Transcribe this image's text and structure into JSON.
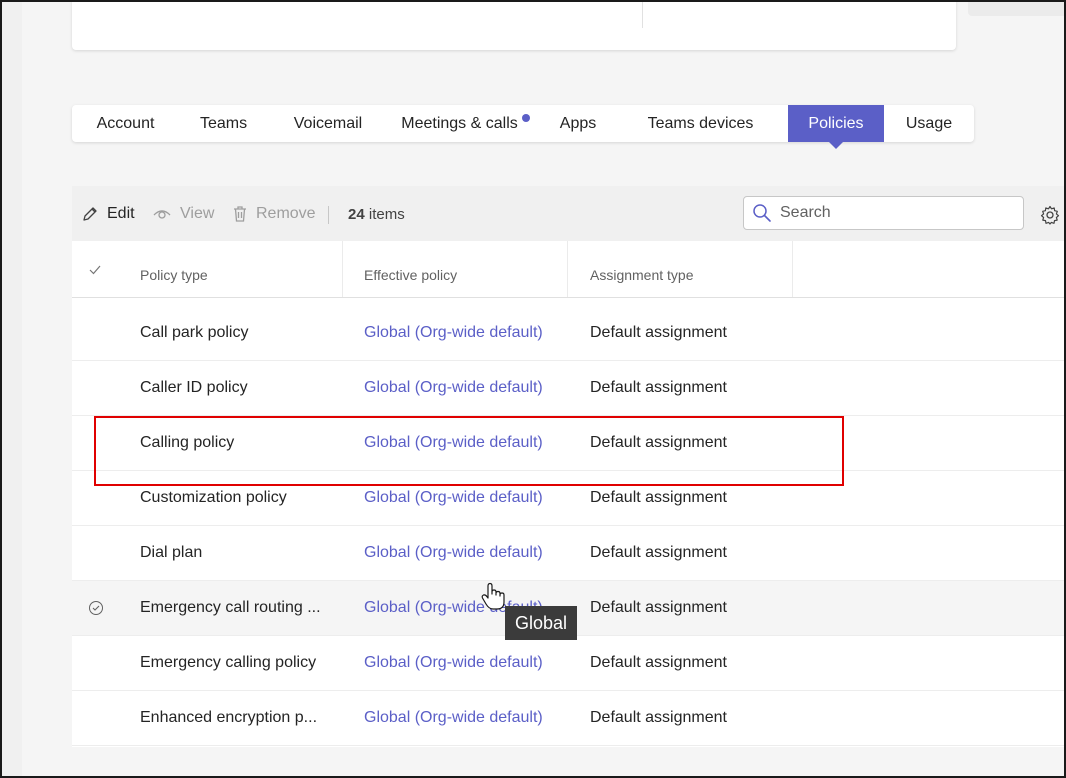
{
  "tabs": [
    {
      "label": "Account",
      "active": false
    },
    {
      "label": "Teams",
      "active": false
    },
    {
      "label": "Voicemail",
      "active": false
    },
    {
      "label": "Meetings & calls",
      "active": false,
      "has_dot": true
    },
    {
      "label": "Apps",
      "active": false
    },
    {
      "label": "Teams devices",
      "active": false
    },
    {
      "label": "Policies",
      "active": true
    },
    {
      "label": "Usage",
      "active": false
    }
  ],
  "toolbar": {
    "edit_label": "Edit",
    "view_label": "View",
    "remove_label": "Remove",
    "item_count": "24",
    "item_count_suffix": "items",
    "search_placeholder": "Search"
  },
  "table": {
    "headers": {
      "policy_type": "Policy type",
      "effective_policy": "Effective policy",
      "assignment_type": "Assignment type"
    },
    "rows": [
      {
        "policy_type": "Call park policy",
        "effective_policy": "Global (Org-wide default)",
        "assignment_type": "Default assignment"
      },
      {
        "policy_type": "Caller ID policy",
        "effective_policy": "Global (Org-wide default)",
        "assignment_type": "Default assignment"
      },
      {
        "policy_type": "Calling policy",
        "effective_policy": "Global (Org-wide default)",
        "assignment_type": "Default assignment"
      },
      {
        "policy_type": "Customization policy",
        "effective_policy": "Global (Org-wide default)",
        "assignment_type": "Default assignment"
      },
      {
        "policy_type": "Dial plan",
        "effective_policy": "Global (Org-wide default)",
        "assignment_type": "Default assignment"
      },
      {
        "policy_type": "Emergency call routing ...",
        "effective_policy": "Global (Org-wide default)",
        "assignment_type": "Default assignment"
      },
      {
        "policy_type": "Emergency calling policy",
        "effective_policy": "Global (Org-wide default)",
        "assignment_type": "Default assignment"
      },
      {
        "policy_type": "Enhanced encryption p...",
        "effective_policy": "Global (Org-wide default)",
        "assignment_type": "Default assignment"
      }
    ]
  },
  "tooltip": {
    "text": "Global"
  },
  "colors": {
    "accent": "#5b5fc7",
    "highlight_border": "#e00000",
    "tooltip_bg": "#3b3b3b"
  }
}
